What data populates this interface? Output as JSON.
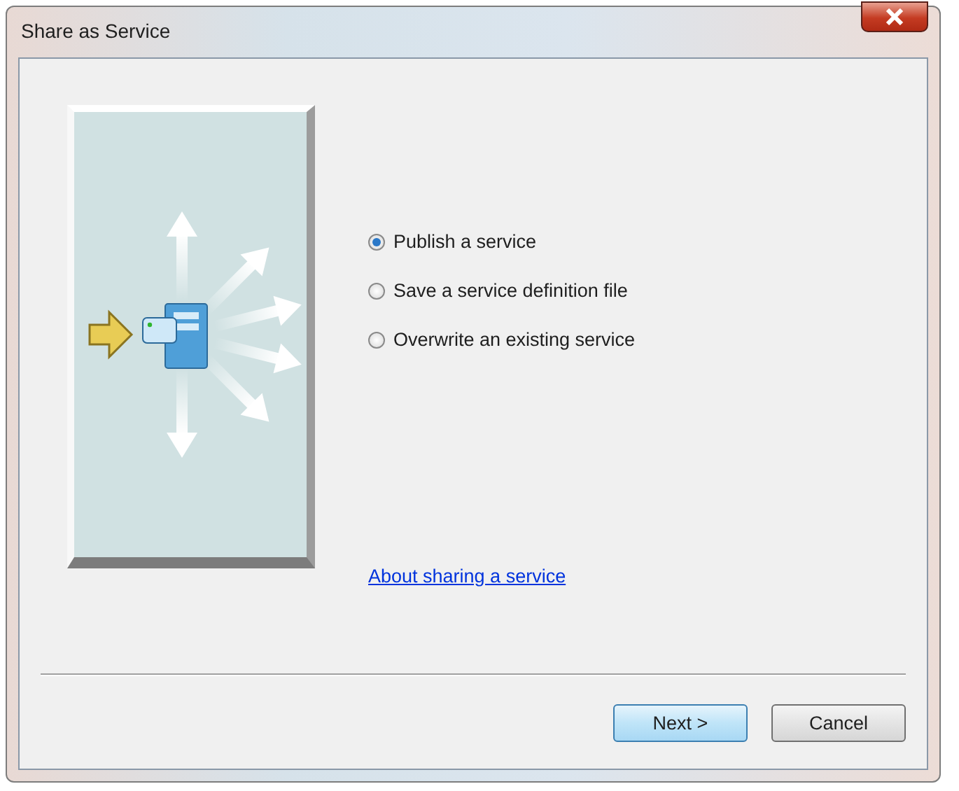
{
  "window": {
    "title": "Share as Service"
  },
  "options": [
    {
      "label": "Publish a service",
      "selected": true
    },
    {
      "label": "Save a service definition file",
      "selected": false
    },
    {
      "label": "Overwrite an existing service",
      "selected": false
    }
  ],
  "link": "About sharing a service",
  "buttons": [
    {
      "label": "Next >",
      "kind": "default"
    },
    {
      "label": "Cancel",
      "kind": "normal"
    }
  ]
}
